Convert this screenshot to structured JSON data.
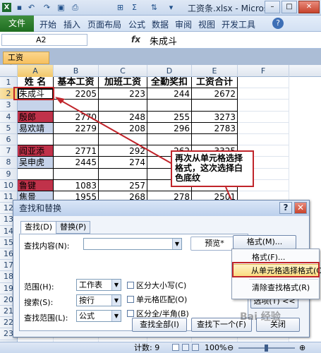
{
  "window": {
    "title": "工资条.xlsx - Micros...",
    "minimize": "–",
    "maximize": "□",
    "close": "✕"
  },
  "quick_access": {
    "icons": [
      "excel-app-icon",
      "save-icon",
      "undo-icon",
      "redo-icon",
      "format-painter-icon",
      "print-icon",
      "borders-icon",
      "sum-icon",
      "sort-icon",
      "customize-icon"
    ]
  },
  "ribbon": {
    "file": "文件",
    "tabs": [
      "开始",
      "插入",
      "页面布局",
      "公式",
      "数据",
      "审阅",
      "视图",
      "开发工具"
    ],
    "help": "?"
  },
  "formula_bar": {
    "name_box": "A2",
    "fx": "fx",
    "value": "朱成斗"
  },
  "workbook_tab": "工资条.xlsx",
  "columns": [
    "A",
    "B",
    "C",
    "D",
    "E",
    "F"
  ],
  "rows": [
    {
      "n": "1",
      "cells": [
        "姓 名",
        "基本工资",
        "加班工资",
        "全勤奖扣",
        "工资合计"
      ],
      "header": true
    },
    {
      "n": "2",
      "cells": [
        "朱成斗",
        "2205",
        "223",
        "244",
        "2672"
      ],
      "fill": "white"
    },
    {
      "n": "3",
      "cells": [
        "",
        "",
        "",
        "",
        ""
      ],
      "fill": "blue"
    },
    {
      "n": "4",
      "cells": [
        "殷郎",
        "2770",
        "248",
        "255",
        "3273"
      ],
      "fill": "red"
    },
    {
      "n": "5",
      "cells": [
        "易欢靖",
        "2279",
        "208",
        "296",
        "2783"
      ],
      "fill": "blue"
    },
    {
      "n": "6",
      "cells": [
        "",
        "",
        "",
        "",
        ""
      ],
      "fill": "white"
    },
    {
      "n": "7",
      "cells": [
        "阎亚添",
        "2771",
        "292",
        "262",
        "3325"
      ],
      "fill": "red"
    },
    {
      "n": "8",
      "cells": [
        "吴申虎",
        "2445",
        "274",
        "",
        "3002"
      ],
      "fill": "blue"
    },
    {
      "n": "9",
      "cells": [
        "",
        "",
        "",
        "",
        ""
      ],
      "fill": "white"
    },
    {
      "n": "10",
      "cells": [
        "鲁键",
        "1083",
        "257",
        "",
        ""
      ],
      "fill": "red"
    },
    {
      "n": "11",
      "cells": [
        "焦景",
        "1955",
        "268",
        "278",
        "2501"
      ],
      "fill": "blue"
    },
    {
      "n": "12",
      "cells": [
        "",
        "",
        "",
        "",
        ""
      ],
      "fill": "white"
    },
    {
      "n": "13",
      "cells": [
        "",
        "",
        "",
        "",
        ""
      ],
      "fill": "white"
    },
    {
      "n": "14",
      "cells": [
        "",
        "",
        "",
        "",
        ""
      ],
      "fill": "white"
    },
    {
      "n": "15",
      "cells": [
        "",
        "",
        "",
        "",
        ""
      ],
      "fill": "white"
    },
    {
      "n": "16",
      "cells": [
        "",
        "",
        "",
        "",
        ""
      ],
      "fill": "white"
    },
    {
      "n": "17",
      "cells": [
        "",
        "",
        "",
        "",
        ""
      ],
      "fill": "white"
    },
    {
      "n": "18",
      "cells": [
        "",
        "",
        "",
        "",
        ""
      ],
      "fill": "white"
    },
    {
      "n": "19",
      "cells": [
        "",
        "",
        "",
        "",
        ""
      ],
      "fill": "white"
    },
    {
      "n": "20",
      "cells": [
        "",
        "",
        "",
        "",
        ""
      ],
      "fill": "white"
    },
    {
      "n": "21",
      "cells": [
        "",
        "",
        "",
        "",
        ""
      ],
      "fill": "white"
    },
    {
      "n": "22",
      "cells": [
        "",
        "",
        "",
        "",
        ""
      ],
      "fill": "white"
    },
    {
      "n": "23",
      "cells": [
        "",
        "",
        "",
        "",
        ""
      ],
      "fill": "white"
    },
    {
      "n": "24",
      "cells": [
        "",
        "",
        "",
        "",
        ""
      ],
      "fill": "white"
    },
    {
      "n": "25",
      "cells": [
        "",
        "",
        "",
        "",
        ""
      ],
      "fill": "white"
    }
  ],
  "colors": {
    "red_fill": "#c0324a",
    "blue_fill": "#c6d3ea",
    "annotation": "#c0242a"
  },
  "callout": {
    "text": "再次从单元格选择格式，这次选择白色底纹"
  },
  "dialog": {
    "title": "查找和替换",
    "help": "?",
    "close": "✕",
    "tabs": [
      "查找(D)",
      "替换(P)"
    ],
    "find_what_label": "查找内容(N):",
    "find_what_value": "",
    "preview": "预览*",
    "format_button": "格式(M)...",
    "within_label": "范围(H):",
    "within_value": "工作表",
    "search_label": "搜索(S):",
    "search_value": "按行",
    "lookin_label": "查找范围(L):",
    "lookin_value": "公式",
    "match_case": "区分大小写(C)",
    "match_entire": "单元格匹配(O)",
    "match_byte": "区分全/半角(B)",
    "options_button": "选项(T) <<",
    "find_all": "查找全部(I)",
    "find_next": "查找下一个(F)",
    "close_button": "关闭"
  },
  "format_menu": {
    "items": [
      "格式(F)...",
      "从单元格选择格式(C)",
      "清除查找格式(R)"
    ],
    "highlighted": 1
  },
  "status_bar": {
    "count": "计数: 9",
    "zoom": "100%",
    "zoom_out": "⊖",
    "zoom_in": "⊕"
  },
  "watermark": "Bai 经验"
}
